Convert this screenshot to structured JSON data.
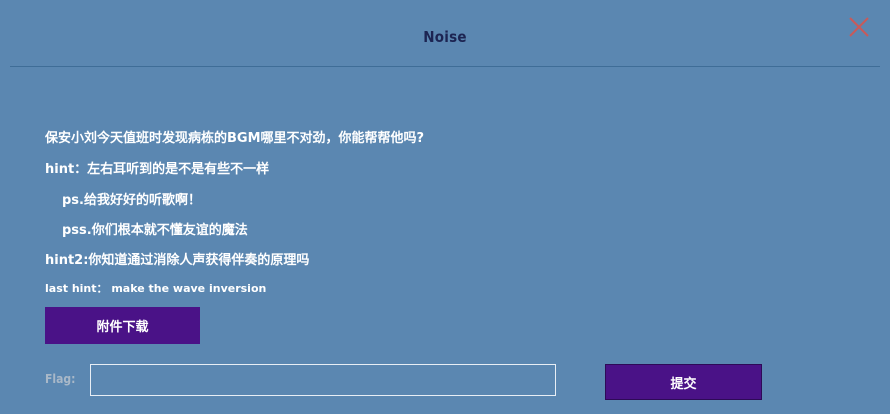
{
  "dialog": {
    "title": "Noise",
    "close_icon": "close-icon",
    "close_color": "#c85a5a"
  },
  "content": {
    "line1": "保安小刘今天值班时发现病栋的BGM哪里不对劲，你能帮帮他吗?",
    "line2": "hint：左右耳听到的是不是有些不一样",
    "line3": "ps.给我好好的听歌啊！",
    "line4": "pss.你们根本就不懂友谊的魔法",
    "line5": "hint2:你知道通过消除人声获得伴奏的原理吗",
    "line6": "last hint： make the wave inversion"
  },
  "download": {
    "label": "附件下载"
  },
  "flag": {
    "label": "Flag:",
    "value": "",
    "placeholder": ""
  },
  "submit": {
    "label": "提交"
  },
  "colors": {
    "background": "#5b87b1",
    "title": "#1c2452",
    "button": "#4a1287",
    "divider": "#3f6d97"
  }
}
